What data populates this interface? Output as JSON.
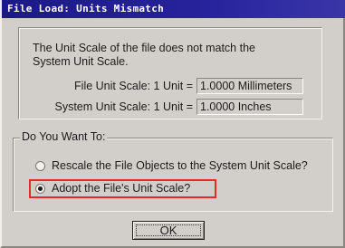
{
  "dialog": {
    "title": "File Load: Units Mismatch",
    "message_line1": "The Unit Scale of the file does not match the",
    "message_line2": "System Unit Scale.",
    "file_scale_label": "File Unit Scale: 1 Unit =",
    "file_scale_value": "1.0000 Millimeters",
    "system_scale_label": "System Unit Scale: 1 Unit =",
    "system_scale_value": "1.0000 Inches",
    "group_label": "Do You Want To:",
    "options": [
      {
        "label": "Rescale the File Objects to the System Unit Scale?",
        "selected": false
      },
      {
        "label": "Adopt the File's Unit Scale?",
        "selected": true
      }
    ],
    "ok_label": "OK",
    "highlight_color": "#e62a2a",
    "title_bar_color": "#1c1a85"
  }
}
